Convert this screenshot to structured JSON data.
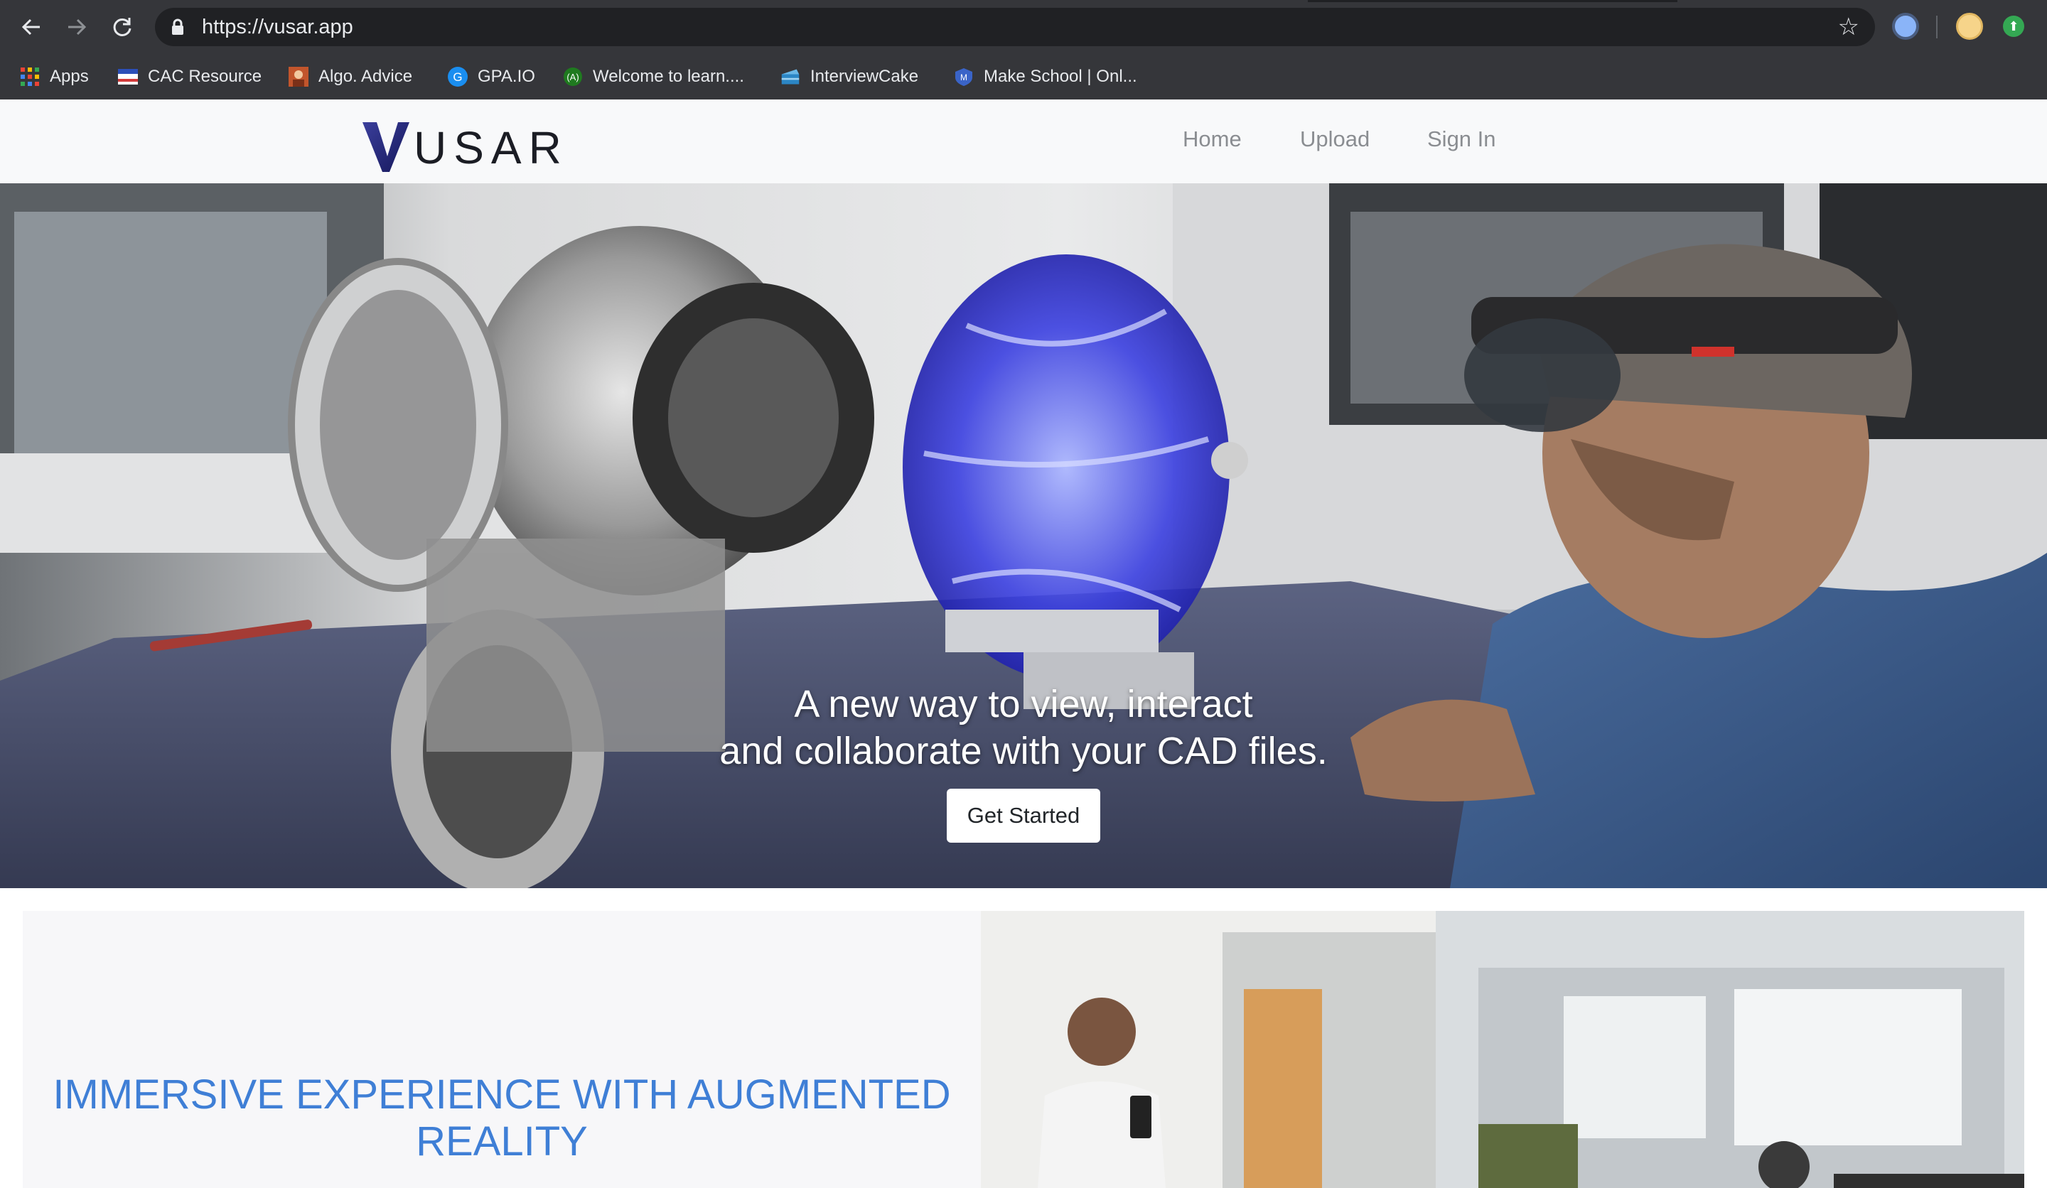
{
  "browser": {
    "url": "https://vusar.app",
    "bookmarks": [
      {
        "label": "Apps",
        "icon": "apps-grid-icon"
      },
      {
        "label": "CAC Resource",
        "icon": "cac-flag-icon"
      },
      {
        "label": "Algo. Advice",
        "icon": "algo-advice-icon"
      },
      {
        "label": "GPA.IO",
        "icon": "gpa-g-icon"
      },
      {
        "label": "Welcome to learn....",
        "icon": "learn-icon"
      },
      {
        "label": "InterviewCake",
        "icon": "interviewcake-icon"
      },
      {
        "label": "Make School | Onl...",
        "icon": "make-school-icon"
      }
    ]
  },
  "site": {
    "logo_text": "USAR",
    "nav": {
      "home": "Home",
      "upload": "Upload",
      "sign_in": "Sign In"
    },
    "hero": {
      "line1": "A new way to view, interact",
      "line2": "and collaborate with your CAD files.",
      "cta": "Get Started"
    },
    "feature": {
      "title_line1": "IMMERSIVE EXPERIENCE WITH AUGMENTED",
      "title_line2": "REALITY"
    }
  },
  "colors": {
    "chrome_bg": "#35363a",
    "omnibox_bg": "#202124",
    "feature_title": "#3f7fd6",
    "logo_v": "#2b2e8c"
  }
}
